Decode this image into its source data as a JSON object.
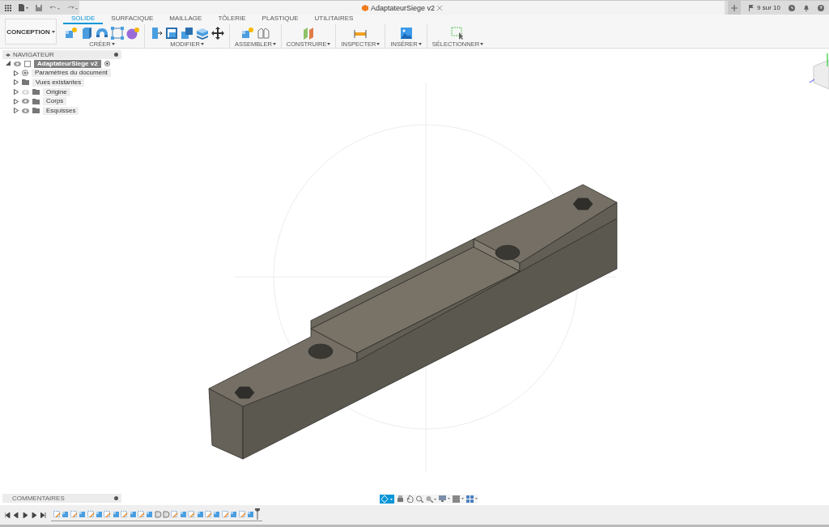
{
  "topbar": {
    "document_tab": {
      "title": "AdaptateurSiege v2"
    },
    "job_status": "9 sur 10"
  },
  "workspace": {
    "label": "CONCEPTION"
  },
  "tabs": [
    {
      "label": "SOLIDE",
      "selected": true
    },
    {
      "label": "SURFACIQUE",
      "selected": false
    },
    {
      "label": "MAILLAGE",
      "selected": false
    },
    {
      "label": "TÔLERIE",
      "selected": false
    },
    {
      "label": "PLASTIQUE",
      "selected": false
    },
    {
      "label": "UTILITAIRES",
      "selected": false
    }
  ],
  "tool_groups": [
    {
      "label": "CRÉER",
      "tools": [
        {
          "kind": "new-component"
        },
        {
          "kind": "extrude"
        },
        {
          "kind": "revolve"
        },
        {
          "kind": "sketch"
        },
        {
          "kind": "form"
        }
      ]
    },
    {
      "label": "MODIFIER",
      "tools": [
        {
          "kind": "press-pull"
        },
        {
          "kind": "shell"
        },
        {
          "kind": "combine"
        },
        {
          "kind": "offset"
        },
        {
          "kind": "move"
        }
      ]
    },
    {
      "label": "ASSEMBLER",
      "tools": [
        {
          "kind": "new-component"
        },
        {
          "kind": "joint"
        }
      ]
    },
    {
      "label": "CONSTRUIRE",
      "tools": [
        {
          "kind": "plane"
        }
      ]
    },
    {
      "label": "INSPECTER",
      "tools": [
        {
          "kind": "measure"
        }
      ]
    },
    {
      "label": "INSÉRER",
      "tools": [
        {
          "kind": "image"
        }
      ]
    },
    {
      "label": "SÉLECTIONNER",
      "tools": [
        {
          "kind": "select"
        }
      ]
    }
  ],
  "navigator": {
    "title": "NAVIGATEUR",
    "root": {
      "label": "AdaptateurSiege v2",
      "expanded": true,
      "selected": true,
      "visible": true,
      "children": [
        {
          "label": "Paramètres du document",
          "kind": "settings",
          "expanded": false,
          "selected": false
        },
        {
          "label": "Vues existantes",
          "kind": "views",
          "expanded": false,
          "selected": false
        },
        {
          "label": "Origine",
          "kind": "folder",
          "visible": false,
          "expanded": false,
          "selected": false
        },
        {
          "label": "Corps",
          "kind": "folder",
          "visible": true,
          "expanded": false,
          "selected": false
        },
        {
          "label": "Esquisses",
          "kind": "folder",
          "visible": true,
          "expanded": false,
          "selected": false
        }
      ]
    }
  },
  "comments": {
    "title": "COMMENTAIRES"
  },
  "timeline": {
    "features": [
      {
        "kind": "sketch"
      },
      {
        "kind": "extrude"
      },
      {
        "kind": "sketch"
      },
      {
        "kind": "extrude"
      },
      {
        "kind": "sketch"
      },
      {
        "kind": "extrude"
      },
      {
        "kind": "sketch"
      },
      {
        "kind": "extrude"
      },
      {
        "kind": "sketch"
      },
      {
        "kind": "extrude"
      },
      {
        "kind": "sketch"
      },
      {
        "kind": "extrude"
      },
      {
        "kind": "hole"
      },
      {
        "kind": "hole"
      },
      {
        "kind": "sketch"
      },
      {
        "kind": "extrude"
      },
      {
        "kind": "sketch"
      },
      {
        "kind": "extrude"
      },
      {
        "kind": "sketch"
      },
      {
        "kind": "extrude"
      },
      {
        "kind": "sketch"
      },
      {
        "kind": "extrude"
      },
      {
        "kind": "sketch"
      },
      {
        "kind": "extrude"
      }
    ]
  }
}
